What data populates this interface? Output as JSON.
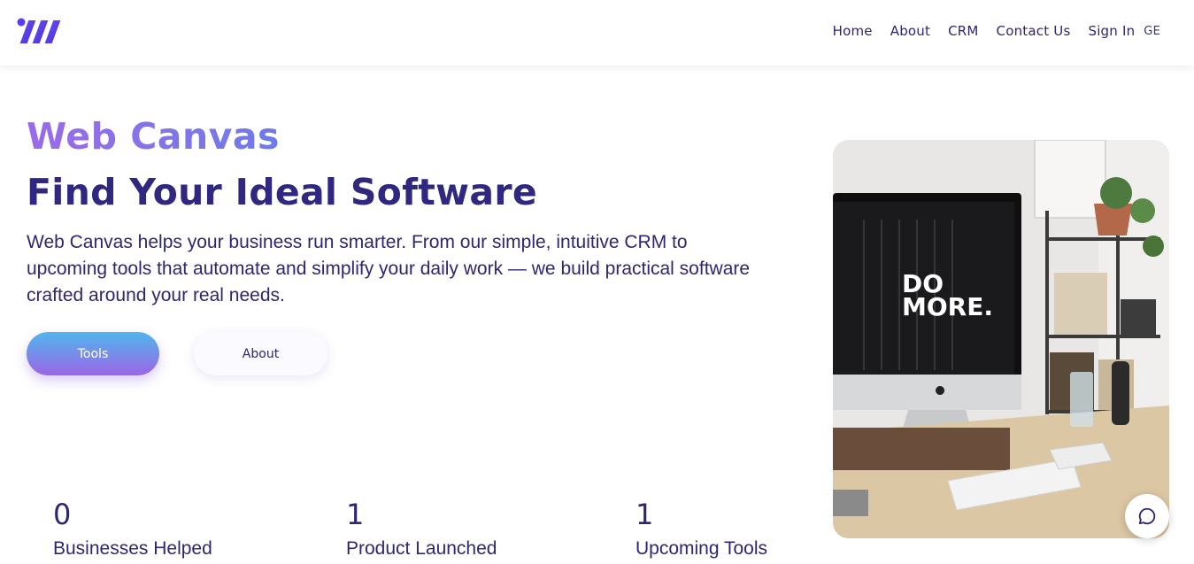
{
  "nav": {
    "home": "Home",
    "about": "About",
    "crm": "CRM",
    "contact": "Contact Us",
    "signin": "Sign In",
    "language": "GE"
  },
  "hero": {
    "brand": "Web Canvas",
    "headline": "Find Your Ideal Software",
    "description": "Web Canvas helps your business run smarter. From our simple, intuitive CRM to upcoming tools that automate and simplify your daily work — we build practical software crafted around your real needs.",
    "tools_button": "Tools",
    "about_button": "About",
    "image_text_line1": "DO",
    "image_text_line2": "MORE."
  },
  "stats": [
    {
      "value": "0",
      "label": "Businesses Helped"
    },
    {
      "value": "1",
      "label": "Product Launched"
    },
    {
      "value": "1",
      "label": "Upcoming Tools"
    }
  ],
  "colors": {
    "primary": "#2f2780",
    "brand_gradient_start": "#9b6be8",
    "brand_gradient_end": "#6e7bea",
    "button_gradient_top": "#4fb6ef",
    "button_gradient_bottom": "#9b66e6"
  },
  "icons": {
    "logo": "logo-icon",
    "chat": "chat-bubble-icon"
  }
}
